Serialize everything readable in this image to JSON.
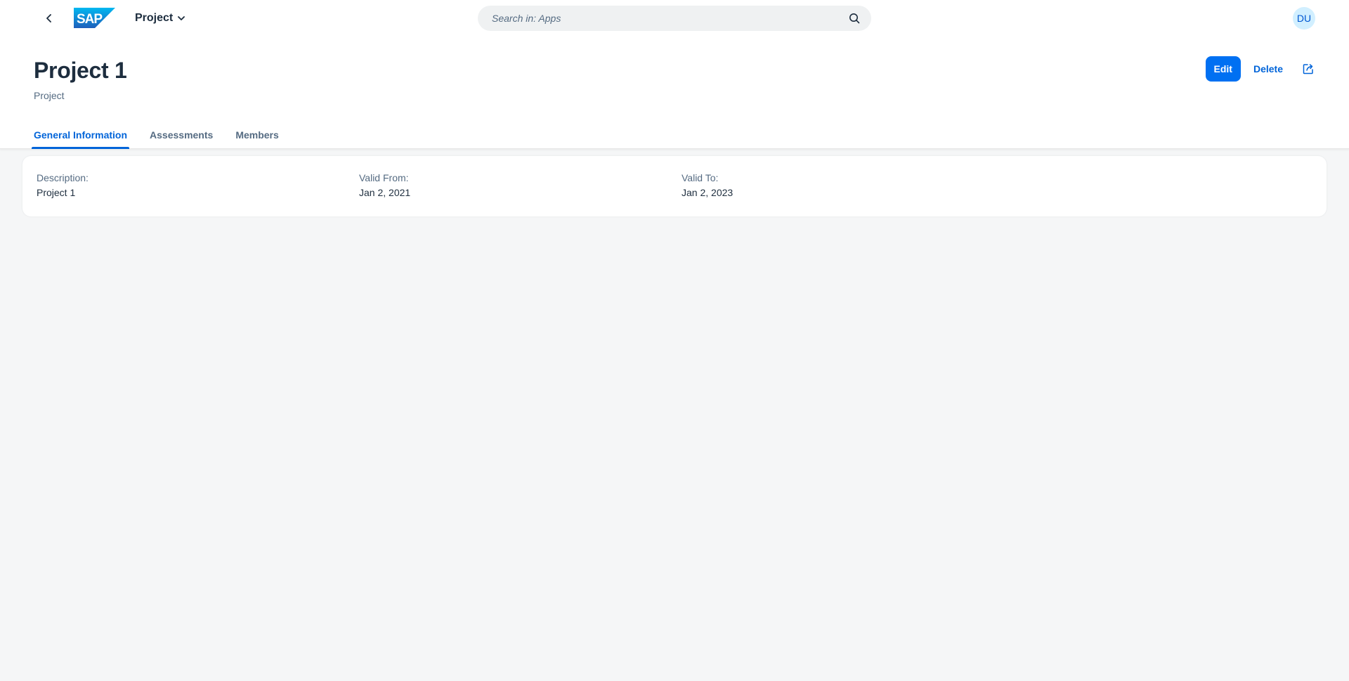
{
  "shellbar": {
    "logo_text": "SAP",
    "app_title": "Project",
    "search_placeholder": "Search in: Apps",
    "avatar_initials": "DU",
    "brand_color": "#0070f2"
  },
  "header": {
    "title": "Project 1",
    "subtitle": "Project",
    "actions": {
      "edit_label": "Edit",
      "delete_label": "Delete"
    },
    "tabs": [
      {
        "label": "General Information",
        "active": true
      },
      {
        "label": "Assessments",
        "active": false
      },
      {
        "label": "Members",
        "active": false
      }
    ]
  },
  "general_info": {
    "fields": [
      {
        "label": "Description:",
        "value": "Project 1"
      },
      {
        "label": "Valid From:",
        "value": "Jan 2, 2021"
      },
      {
        "label": "Valid To:",
        "value": "Jan 2, 2023"
      }
    ]
  },
  "icons": {
    "back": "chevron-left-icon",
    "app_menu": "chevron-down-icon",
    "search": "search-icon",
    "share": "share-icon"
  }
}
